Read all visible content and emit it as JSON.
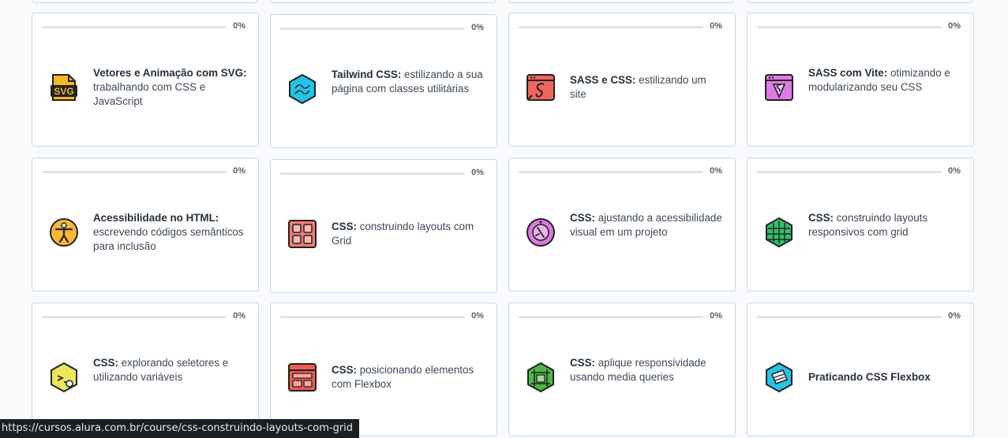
{
  "courses": [
    {
      "bold": "Vetores e Animação com SVG:",
      "rest": " trabalhando com CSS e JavaScript",
      "progress": "0%",
      "progress_value": 0,
      "icon": "svg-icon",
      "icon_text": "SVG"
    },
    {
      "bold": "Tailwind CSS:",
      "rest": " estilizando a sua página com classes utilitárias",
      "progress": "0%",
      "progress_value": 0,
      "icon": "tailwind-icon"
    },
    {
      "bold": "SASS e CSS:",
      "rest": " estilizando um site",
      "progress": "0%",
      "progress_value": 0,
      "icon": "sass-icon"
    },
    {
      "bold": "SASS com Vite:",
      "rest": " otimizando e modularizando seu CSS",
      "progress": "0%",
      "progress_value": 0,
      "icon": "vite-icon"
    },
    {
      "bold": "Acessibilidade no HTML:",
      "rest": " escrevendo códigos semânticos para inclusão",
      "progress": "0%",
      "progress_value": 0,
      "icon": "accessibility-icon"
    },
    {
      "bold": "CSS:",
      "rest": " construindo layouts com Grid",
      "progress": "0%",
      "progress_value": 0,
      "icon": "grid-layout-icon"
    },
    {
      "bold": "CSS:",
      "rest": " ajustando a acessibilidade visual em um projeto",
      "progress": "0%",
      "progress_value": 0,
      "icon": "visual-accessibility-icon"
    },
    {
      "bold": "CSS:",
      "rest": " construindo layouts responsivos com grid",
      "progress": "0%",
      "progress_value": 0,
      "icon": "responsive-grid-icon"
    },
    {
      "bold": "CSS:",
      "rest": " explorando seletores e utilizando variáveis",
      "progress": "0%",
      "progress_value": 0,
      "icon": "selectors-icon"
    },
    {
      "bold": "CSS:",
      "rest": " posicionando elementos com Flexbox",
      "progress": "0%",
      "progress_value": 0,
      "icon": "flexbox-layout-icon"
    },
    {
      "bold": "CSS:",
      "rest": " aplique responsividade usando media queries",
      "progress": "0%",
      "progress_value": 0,
      "icon": "media-queries-icon"
    },
    {
      "bold": "Praticando CSS Flexbox",
      "rest": "",
      "progress": "0%",
      "progress_value": 0,
      "icon": "flexbox-practice-icon"
    }
  ],
  "status_bar": {
    "url": "https://cursos.alura.com.br/course/css-construindo-layouts-com-grid"
  },
  "colors": {
    "progress_track": "#dfe3e8",
    "progress_fill": "#0ec2a5",
    "card_border": "#c9d6e6"
  }
}
